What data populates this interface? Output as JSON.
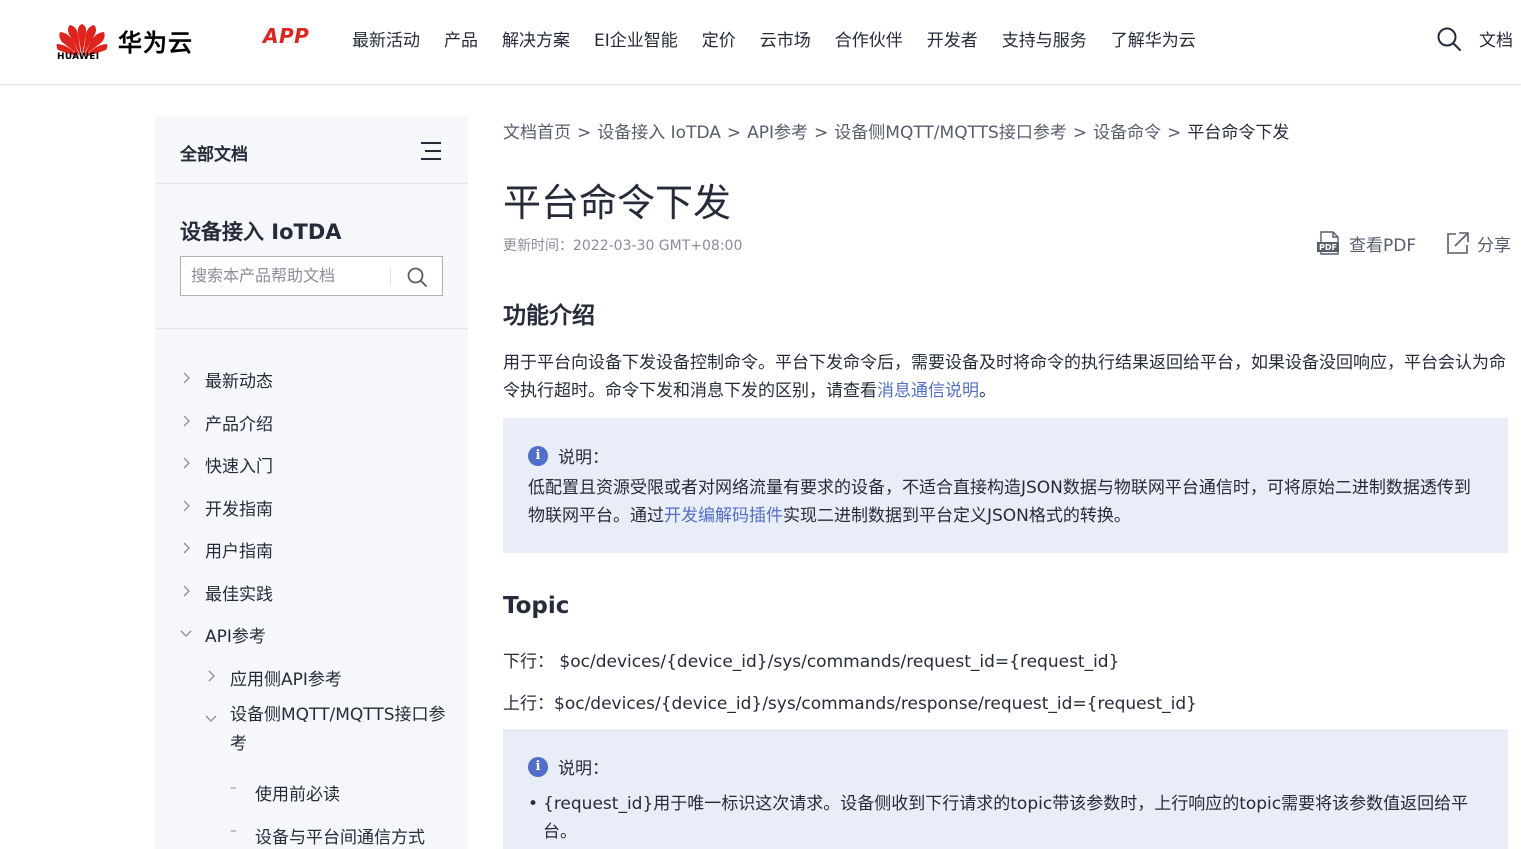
{
  "header": {
    "brand_name": "华为云",
    "logo_text": "HUAWEI",
    "app_label": "APP",
    "nav_items": [
      "最新活动",
      "产品",
      "解决方案",
      "EI企业智能",
      "定价",
      "云市场",
      "合作伙伴",
      "开发者",
      "支持与服务",
      "了解华为云"
    ],
    "doc_label": "文档",
    "accent_color": "#e0231c"
  },
  "sidebar": {
    "all_docs": "全部文档",
    "product_title": "设备接入 IoTDA",
    "search_placeholder": "搜索本产品帮助文档",
    "tree": [
      {
        "label": "最新动态",
        "state": "collapsed"
      },
      {
        "label": "产品介绍",
        "state": "collapsed"
      },
      {
        "label": "快速入门",
        "state": "collapsed"
      },
      {
        "label": "开发指南",
        "state": "collapsed"
      },
      {
        "label": "用户指南",
        "state": "collapsed"
      },
      {
        "label": "最佳实践",
        "state": "collapsed"
      },
      {
        "label": "API参考",
        "state": "expanded"
      },
      {
        "label": "应用侧API参考",
        "state": "collapsed"
      },
      {
        "label": "设备侧MQTT/MQTTS接口参考",
        "state": "expanded"
      },
      {
        "label": "使用前必读",
        "state": "leaf"
      },
      {
        "label": "设备与平台间通信方式",
        "state": "leaf"
      }
    ]
  },
  "breadcrumb": [
    "文档首页",
    "设备接入 IoTDA",
    "API参考",
    "设备侧MQTT/MQTTS接口参考",
    "设备命令",
    "平台命令下发"
  ],
  "breadcrumb_sep": ">",
  "page": {
    "title": "平台命令下发",
    "updated": "更新时间：2022-03-30 GMT+08:00",
    "pdf_label": "查看PDF",
    "share_label": "分享"
  },
  "section_intro": {
    "heading": "功能介绍",
    "text_before": "用于平台向设备下发设备控制命令。平台下发命令后，需要设备及时将命令的执行结果返回给平台，如果设备没回响应，平台会认为命令执行超时。命令下发和消息下发的区别，请查看",
    "link": "消息通信说明",
    "text_after": "。"
  },
  "note1": {
    "title": "说明：",
    "text_before": "低配置且资源受限或者对网络流量有要求的设备，不适合直接构造JSON数据与物联网平台通信时，可将原始二进制数据透传到物联网平台。通过",
    "link": "开发编解码插件",
    "text_after": "实现二进制数据到平台定义JSON格式的转换。"
  },
  "section_topic": {
    "heading": "Topic",
    "down_label": "下行：",
    "down_value": "$oc/devices/{device_id}/sys/commands/request_id={request_id}",
    "up_label": "上行：",
    "up_value": "$oc/devices/{device_id}/sys/commands/response/request_id={request_id}"
  },
  "note2": {
    "title": "说明：",
    "bullet": "{request_id}用于唯一标识这次请求。设备侧收到下行请求的topic带该参数时，上行响应的topic需要将该参数值返回给平台。"
  },
  "colors": {
    "link": "#526ecc",
    "note_bg": "#e8edf7",
    "sidebar_bg": "#f5f7fa"
  }
}
